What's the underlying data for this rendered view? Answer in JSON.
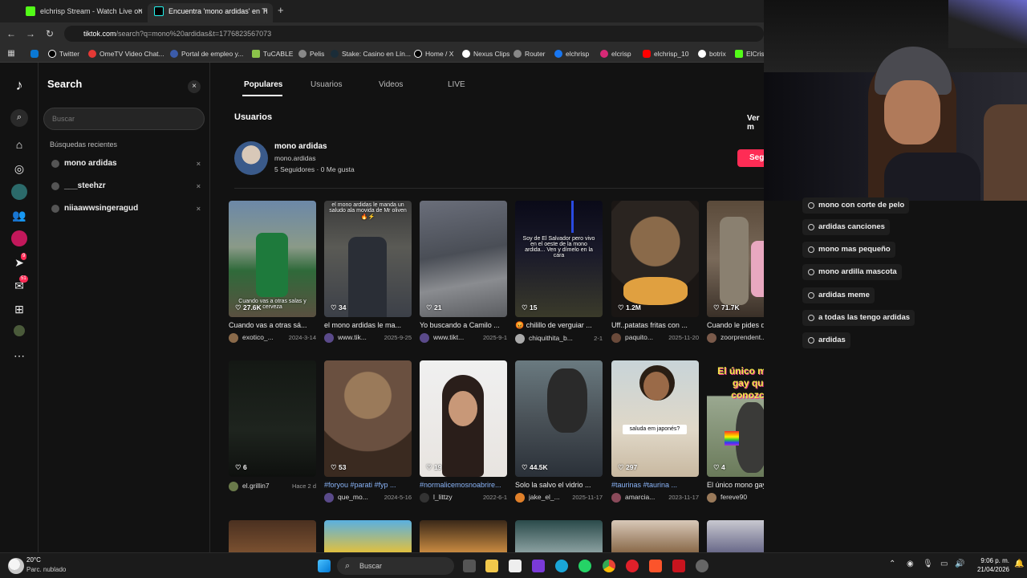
{
  "browser": {
    "tabs": [
      {
        "title": "elchrisp Stream - Watch Live on",
        "close": "×"
      },
      {
        "title": "Encuentra 'mono ardidas' en Ti",
        "close": "×"
      }
    ],
    "new_tab": "+",
    "url_host": "tiktok.com",
    "url_path": "/search?q=mono%20ardidas&t=1776823567073",
    "bookmarks": [
      "Twitter",
      "OmeTV Video Chat...",
      "Portal de empleo y...",
      "TuCABLE",
      "Pelis",
      "Stake: Casino en Lín...",
      "Home / X",
      "Nexus Clips",
      "Router",
      "elchrisp",
      "elcrisp",
      "elchrisp_10",
      "botrix",
      "ElCris"
    ]
  },
  "search_panel": {
    "title": "Search",
    "close": "×",
    "placeholder": "Buscar",
    "recent_title": "Búsquedas recientes",
    "recent": [
      "mono ardidas",
      "___steehzr",
      "niiaawwsingeragud"
    ],
    "remove": "×"
  },
  "main": {
    "tabs": [
      "Populares",
      "Usuarios",
      "Videos",
      "LIVE"
    ],
    "users_heading": "Usuarios",
    "see_more": "Ver m",
    "user": {
      "name": "mono ardidas",
      "handle": "mono.ardidas",
      "followers": "5 Seguidores",
      "dot": "·",
      "likes": "0 Me gusta",
      "follow": "Seg"
    },
    "videos": [
      {
        "likes": "27.6K",
        "title": "Cuando vas a otras sá...",
        "author": "exotico_...",
        "date": "2024-3-14",
        "tag": false,
        "overlay": "Cuando vas a otras salas y cerveza"
      },
      {
        "likes": "34",
        "title": "el mono ardidas le ma...",
        "author": "www.tik...",
        "date": "2025-9-25",
        "tag": false,
        "overlay": "el mono ardidas le manda un saludo ala movida de Mr oliven 🔥⚡"
      },
      {
        "likes": "21",
        "title": "Yo buscando a Camilo ...",
        "author": "www.tikt...",
        "date": "2025-9-1",
        "tag": false,
        "overlay": ""
      },
      {
        "likes": "15",
        "title": "😡 chilillo de verguiar ...",
        "author": "chiquithita_b...",
        "date": "2-1",
        "tag": false,
        "overlay": "Soy de El Salvador pero vivo en el oeste de la mono ardida... Ven y dímelo en la cara"
      },
      {
        "likes": "1.2M",
        "title": "Uff..patatas fritas con ...",
        "author": "paquito...",
        "date": "2025-11-20",
        "tag": false,
        "overlay": ""
      },
      {
        "likes": "71.7K",
        "title": "Cuando le pides dinero...",
        "author": "zoorprendent...",
        "date": "4-5",
        "tag": false,
        "overlay": ""
      },
      {
        "likes": "6",
        "title": "",
        "author": "el.grillin7",
        "date": "Hace 2 d",
        "tag": false,
        "overlay": ""
      },
      {
        "likes": "53",
        "title": "#foryou #parati #fyp ...",
        "author": "que_mo...",
        "date": "2024-5-16",
        "tag": true,
        "overlay": ""
      },
      {
        "likes": "19",
        "title": "#normalicemosnoabrire...",
        "author": "l_littzy",
        "date": "2022-6-1",
        "tag": true,
        "overlay": ""
      },
      {
        "likes": "44.5K",
        "title": "Solo la salvo el vidrio ...",
        "author": "jake_el_...",
        "date": "2025-11-17",
        "tag": false,
        "overlay": ""
      },
      {
        "likes": "297",
        "title": "#taurinas #taurina ...",
        "author": "amarcia...",
        "date": "2023-11-17",
        "tag": true,
        "overlay": "saluda em japonés?"
      },
      {
        "likes": "4",
        "title": "El único mono gay que...",
        "author": "fereve90",
        "date": "2025-12-20",
        "tag": false,
        "overlay": "El único mono gay que conozco"
      }
    ]
  },
  "suggestions": [
    "mono con corte de pelo",
    "ardidas canciones",
    "mono mas pequeño",
    "mono ardilla mascota",
    "ardidas meme",
    "a todas las tengo ardidas",
    "ardidas"
  ],
  "taskbar": {
    "weather_temp": "20°C",
    "weather_desc": "Parc. nublado",
    "search": "Buscar",
    "time": "9:06 p. m.",
    "date": "21/04/2026"
  },
  "colors": {
    "accent": "#fe2c55",
    "background": "#121212"
  }
}
